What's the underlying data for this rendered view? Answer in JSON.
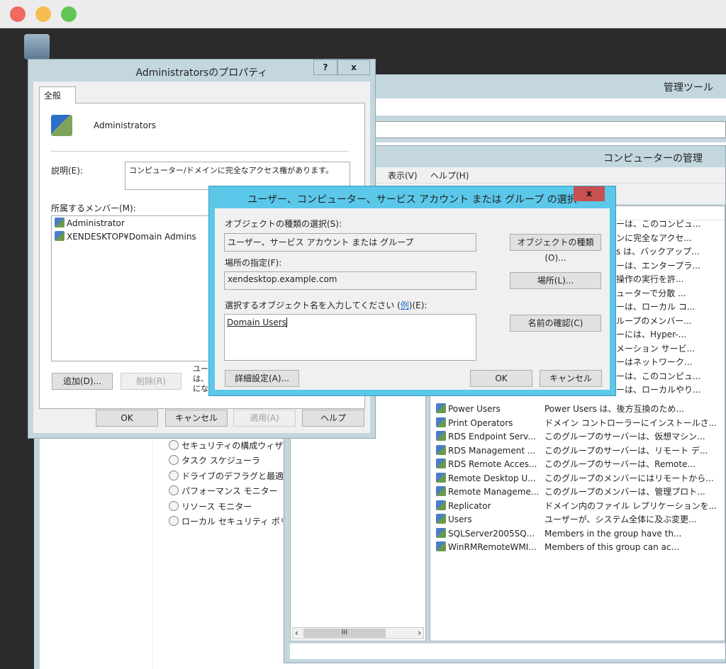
{
  "colors": {
    "desktop": "#2b2b2b",
    "dialog_frame": "#c4d7df",
    "select_frame": "#5bc8ea",
    "close_red": "#c75050"
  },
  "desktop": {
    "icon": "recycle-bin-icon"
  },
  "admin_tools": {
    "title": "管理ツール",
    "tree_items": [
      "セキュリティの構成ウィザード",
      "タスク スケジューラ",
      "ドライブのデフラグと最適化",
      "パフォーマンス モニター",
      "リソース モニター",
      "ローカル セキュリティ ポリシー"
    ]
  },
  "computer_mgmt": {
    "title": "コンピューターの管理",
    "menu": [
      "表示(V)",
      "ヘルプ(H)"
    ],
    "partial_descriptions": [
      "ーは、このコンピュ...",
      "ンに完全なアクセ...",
      "s は、バックアップ...",
      "ーは、エンタープラ...",
      "操作の実行を許...",
      "ューターで分散 ...",
      "ーは、ローカル コ...",
      "ループのメンバー...",
      "ーには、Hyper-...",
      "メーション サービ...",
      "ーはネットワーク...",
      "ーは、このコンピュ...",
      "ーは、ローカルやり..."
    ],
    "groups": [
      {
        "name": "Power Users",
        "desc": "Power Users は、後方互換のため..."
      },
      {
        "name": "Print Operators",
        "desc": "ドメイン コントローラーにインストールさ..."
      },
      {
        "name": "RDS Endpoint Serv...",
        "desc": "このグループのサーバーは、仮想マシン..."
      },
      {
        "name": "RDS Management ...",
        "desc": "このグループのサーバーは、リモート デ..."
      },
      {
        "name": "RDS Remote Acces...",
        "desc": "このグループのサーバーは、Remote..."
      },
      {
        "name": "Remote Desktop U...",
        "desc": "このグループのメンバーにはリモートから..."
      },
      {
        "name": "Remote Manageme...",
        "desc": "このグループのメンバーは、管理プロト..."
      },
      {
        "name": "Replicator",
        "desc": "ドメイン内のファイル レプリケーションを..."
      },
      {
        "name": "Users",
        "desc": "ユーザーが、システム全体に及ぶ変更..."
      },
      {
        "name": "SQLServer2005SQ...",
        "desc": "Members in the group have th..."
      },
      {
        "name": "WinRMRemoteWMI...",
        "desc": "Members of this group can ac..."
      }
    ],
    "scroll_grip": "III"
  },
  "props": {
    "title": "Administratorsのプロパティ",
    "help": "?",
    "close": "x",
    "tab": "全般",
    "group_name": "Administrators",
    "desc_label": "説明(E):",
    "desc_value": "コンピューター/ドメインに完全なアクセス権があります。",
    "members_label": "所属するメンバー(M):",
    "members": [
      "Administrator",
      "XENDESKTOP¥Domain Admins"
    ],
    "note": [
      "ユー",
      "は、そ",
      "になり"
    ],
    "add": "追加(D)...",
    "remove": "削除(R)",
    "ok": "OK",
    "cancel": "キャンセル",
    "apply": "適用(A)",
    "helpbtn": "ヘルプ"
  },
  "select": {
    "title": "ユーザー、コンピューター、サービス アカウント または グループ の選択",
    "close": "x",
    "type_label": "オブジェクトの種類の選択(S):",
    "type_value": "ユーザー、サービス アカウント または グループ",
    "type_btn": "オブジェクトの種類(O)...",
    "loc_label": "場所の指定(F):",
    "loc_value": "xendesktop.example.com",
    "loc_btn": "場所(L)...",
    "name_label_a": "選択するオブジェクト名を入力してください (",
    "name_label_link": "例",
    "name_label_b": ")(E):",
    "name_value": "Domain Users",
    "check_btn": "名前の確認(C)",
    "advanced": "詳細設定(A)...",
    "ok": "OK",
    "cancel": "キャンセル"
  }
}
